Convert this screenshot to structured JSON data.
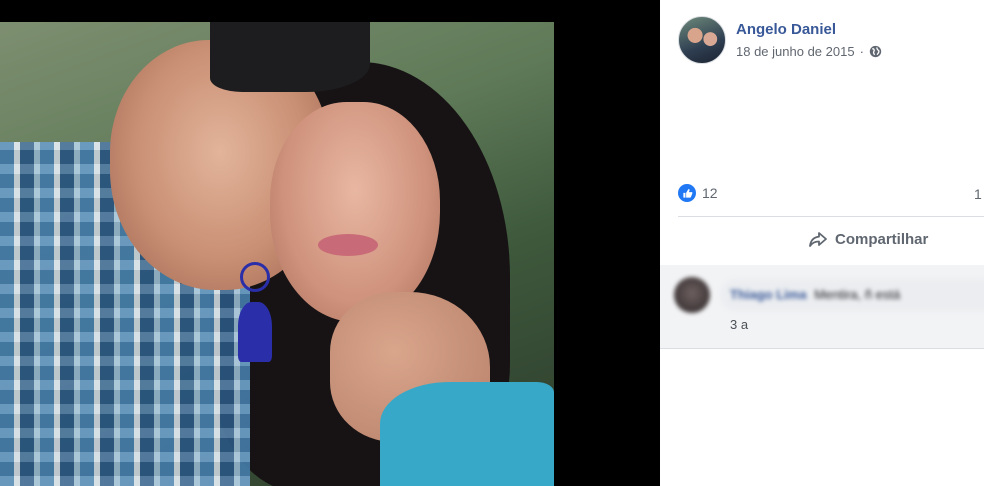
{
  "post": {
    "author": "Angelo Daniel",
    "date": "18 de junho de 2015",
    "separator": "·",
    "privacy_icon": "globe-icon",
    "likes": "12",
    "comments_count": "1"
  },
  "actions": {
    "share_label": "Compartilhar"
  },
  "comment": {
    "author_blurred": "Thiago Lima",
    "text_blurred": "Mentira, ñ está",
    "time": "3 a"
  },
  "colors": {
    "link": "#385898",
    "like_blue": "#2078f4",
    "meta_gray": "#616770",
    "comment_bg": "#f2f3f5"
  }
}
